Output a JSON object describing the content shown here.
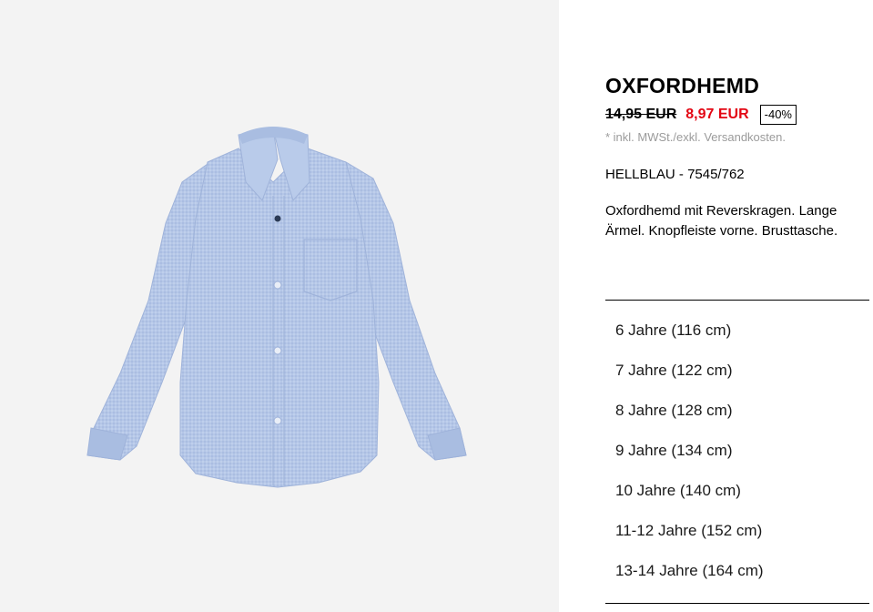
{
  "product": {
    "title": "OXFORDHEMD",
    "old_price": "14,95 EUR",
    "new_price": "8,97 EUR",
    "discount": "-40%",
    "tax_note_prefix": "* inkl. MWSt./",
    "tax_note_link": "exkl. Versandkosten",
    "tax_note_suffix": ".",
    "color_label": "HELLBLAU",
    "color_sep": " - ",
    "reference": "7545/762",
    "description": "Oxfordhemd mit Reverskragen. Lange Ärmel. Knopfleiste vorne. Brusttasche.",
    "image_icon": "shirt-product-photo"
  },
  "sizes": [
    {
      "label": "6 Jahre (116 cm)"
    },
    {
      "label": "7 Jahre (122 cm)"
    },
    {
      "label": "8 Jahre (128 cm)"
    },
    {
      "label": "9 Jahre (134 cm)"
    },
    {
      "label": "10 Jahre (140 cm)"
    },
    {
      "label": "11-12 Jahre (152 cm)"
    },
    {
      "label": "13-14 Jahre (164 cm)"
    }
  ],
  "colors": {
    "sale_red": "#e30613",
    "muted_text": "#9b9b9b",
    "image_bg": "#f3f3f3",
    "shirt_blue": "#b4c6e6"
  }
}
